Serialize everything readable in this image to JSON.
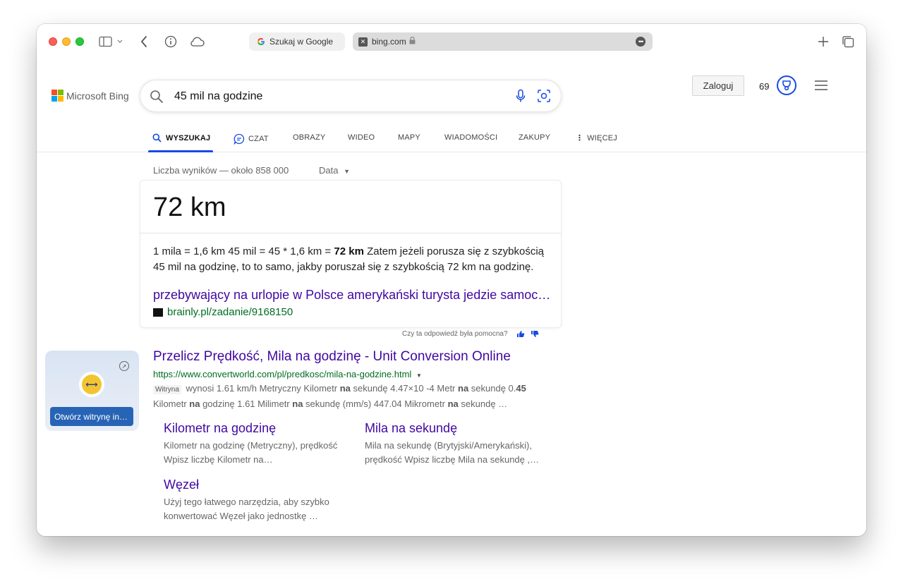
{
  "browser": {
    "tabs": [
      {
        "label": "Szukaj w Google",
        "icon": "google-favicon"
      },
      {
        "label": "bing.com",
        "icon": "bing-favicon"
      }
    ],
    "new_tab_icon": "plus-icon",
    "tab_overview_icon": "tab-overview-icon"
  },
  "bing": {
    "logo_text": "Microsoft Bing",
    "search_query": "45 mil na godzine",
    "login_label": "Zaloguj",
    "points": "69",
    "nav": [
      {
        "label": "WYSZUKAJ",
        "icon": "search-icon"
      },
      {
        "label": "CZAT",
        "icon": "chat-icon"
      },
      {
        "label": "OBRAZY"
      },
      {
        "label": "WIDEO"
      },
      {
        "label": "MAPY"
      },
      {
        "label": "WIADOMOŚCI"
      },
      {
        "label": "ZAKUPY"
      },
      {
        "label": "WIĘCEJ",
        "icon": "more-vertical-icon"
      }
    ],
    "results_count": "Liczba wyników — około 858 000",
    "date_filter": "Data"
  },
  "answer": {
    "big_value": "72 km",
    "text_prefix": "1 mila = 1,6 km 45 mil = 45 * 1,6 km = ",
    "text_bold": "72 km",
    "text_suffix": " Zatem jeżeli porusza się z szybkością 45 mil na godzinę, to to samo, jakby poruszał się z szybkością 72 km na godzinę.",
    "link_title": "przebywający na urlopie w Polsce amerykański turysta jedzie samoc…",
    "source": "brainly.pl/zadanie/9168150",
    "feedback": "Czy ta odpowiedź była pomocna?"
  },
  "preview": {
    "open_label": "Otwórz witrynę in…"
  },
  "result": {
    "title": "Przelicz Prędkość, Mila na godzinę - Unit Conversion Online",
    "url": "https://www.convertworld.com/pl/predkosc/mila-na-godzine.html",
    "tag": "Witryna",
    "snippet_1": " wynosi 1.61 km/h Metryczny Kilometr ",
    "bold_na": "na",
    "snippet_2": " sekundę 4.47×10 -4 Metr ",
    "snippet_3": " sekundę 0.",
    "bold_45": "45",
    "snippet_4": " Kilometr ",
    "snippet_5": " godzinę 1.61 Milimetr ",
    "snippet_6": " sekundę (mm/s) 447.04 Mikrometr ",
    "snippet_7": " sekundę …",
    "deeplinks": [
      {
        "title": "Kilometr na godzinę",
        "desc": "Kilometr na godzinę (Metryczny), prędkość Wpisz liczbę Kilometr na…"
      },
      {
        "title": "Mila na sekundę",
        "desc": "Mila na sekundę (Brytyjski/Amerykański), prędkość Wpisz liczbę Mila na sekundę ,…"
      },
      {
        "title": "Węzeł",
        "desc": "Użyj tego łatwego narzędzia, aby szybko konwertować Węzeł jako jednostkę …"
      }
    ]
  },
  "colors": {
    "link": "#4007a2",
    "url_green": "#006d21",
    "accent_blue": "#174ae4"
  }
}
